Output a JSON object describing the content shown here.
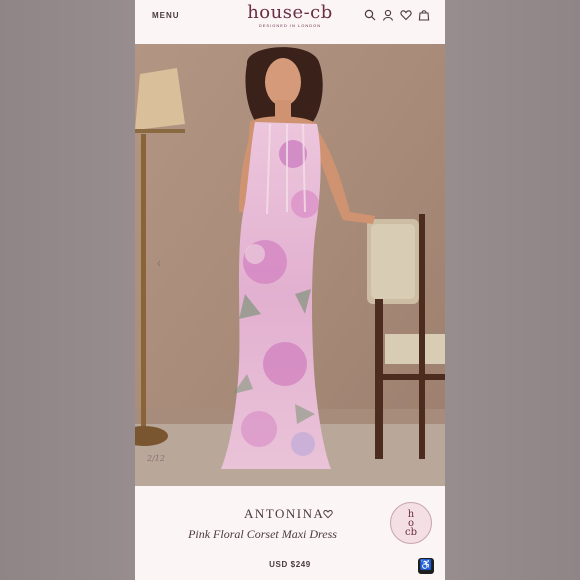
{
  "header": {
    "menu_label": "MENU",
    "logo": "house-cb",
    "tagline": "DESIGNED IN LONDON",
    "icons": [
      "search-icon",
      "account-icon",
      "heart-icon",
      "bag-icon"
    ]
  },
  "gallery": {
    "counter": "2/12",
    "prev_icon": "chevron-left-icon"
  },
  "product": {
    "name": "ANTONINA",
    "subtitle": "Pink Floral Corset Maxi Dress",
    "price": "USD $249",
    "badge_icon": "house-of-cb-seal"
  },
  "colors": {
    "brand": "#6b2d44",
    "panel": "#fbf5f6",
    "dress_pink": "#e9b6d2"
  }
}
